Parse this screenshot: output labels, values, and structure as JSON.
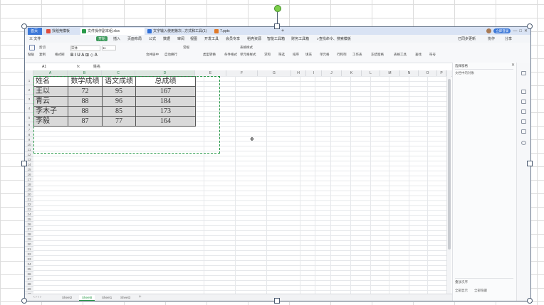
{
  "tabs": {
    "home": "首页",
    "t1": "找稻壳模板",
    "t2": "文件操作副本组.xlsx",
    "t3": "文字输入使用第次...方式和工具(1)",
    "t4": "7.pptx",
    "add": "+"
  },
  "window": {
    "login": "立即登录",
    "min": "—",
    "max": "□",
    "close": "✕"
  },
  "menu": {
    "file": "三 文件",
    "items": [
      "开始",
      "插入",
      "页面布局",
      "公式",
      "数据",
      "审阅",
      "视图",
      "开发工具",
      "会员专享",
      "稻壳资源",
      "智能工具箱",
      "财务工具箱"
    ],
    "search": "查找命令、搜索模板",
    "sync": "已同步更新",
    "collab": "协作",
    "share": "分享"
  },
  "toolbar": {
    "paste": "粘贴",
    "cut": "剪切",
    "copy": "复制",
    "format_painter": "格式刷",
    "font": "宋体",
    "size": "11",
    "merge": "合并居中",
    "wrap": "自动换行",
    "numfmt": "常规",
    "typeconv": "类型转换",
    "cond": "条件格式",
    "cellstyle": "单元格样式",
    "table_style": "表格样式",
    "sum": "求和",
    "filter": "筛选",
    "sort": "排序",
    "fill": "填充",
    "cell": "单元格",
    "rowcol": "行和列",
    "worksheet": "工作表",
    "freeze": "冻结窗格",
    "tabletools": "表格工具",
    "find": "查找",
    "settings": "符号"
  },
  "formula_bar": {
    "cell_ref": "A1",
    "fx": "fx",
    "content": "姓名"
  },
  "columns": [
    "A",
    "B",
    "C",
    "D",
    "E",
    "F",
    "G",
    "H",
    "I",
    "J",
    "K",
    "L",
    "M",
    "N",
    "O",
    "P"
  ],
  "rows": [
    "1",
    "2",
    "3",
    "4",
    "5",
    "6",
    "7",
    "8",
    "9",
    "10",
    "11",
    "12",
    "13",
    "14",
    "15",
    "16",
    "17",
    "18",
    "19",
    "20",
    "21",
    "22",
    "23",
    "24",
    "25",
    "26",
    "27",
    "28",
    "29",
    "30",
    "31",
    "32",
    "33",
    "34",
    "35",
    "36",
    "37",
    "38",
    "39",
    "40"
  ],
  "table": {
    "headers": [
      "姓名",
      "数学成绩",
      "语文成绩",
      "总成绩"
    ],
    "rows": [
      [
        "王以",
        "72",
        "95",
        "167"
      ],
      [
        "青云",
        "88",
        "96",
        "184"
      ],
      [
        "李木子",
        "88",
        "85",
        "173"
      ],
      [
        "李毅",
        "87",
        "77",
        "164"
      ]
    ]
  },
  "sheets": [
    "Sheet2",
    "Sheet8",
    "Sheet1",
    "Sheet3"
  ],
  "active_sheet": "Sheet8",
  "panel": {
    "title": "选择窗格",
    "subtitle": "文档中的对象",
    "bottom_label": "叠放次序",
    "show_all": "全部显示",
    "hide_all": "全部隐藏"
  }
}
